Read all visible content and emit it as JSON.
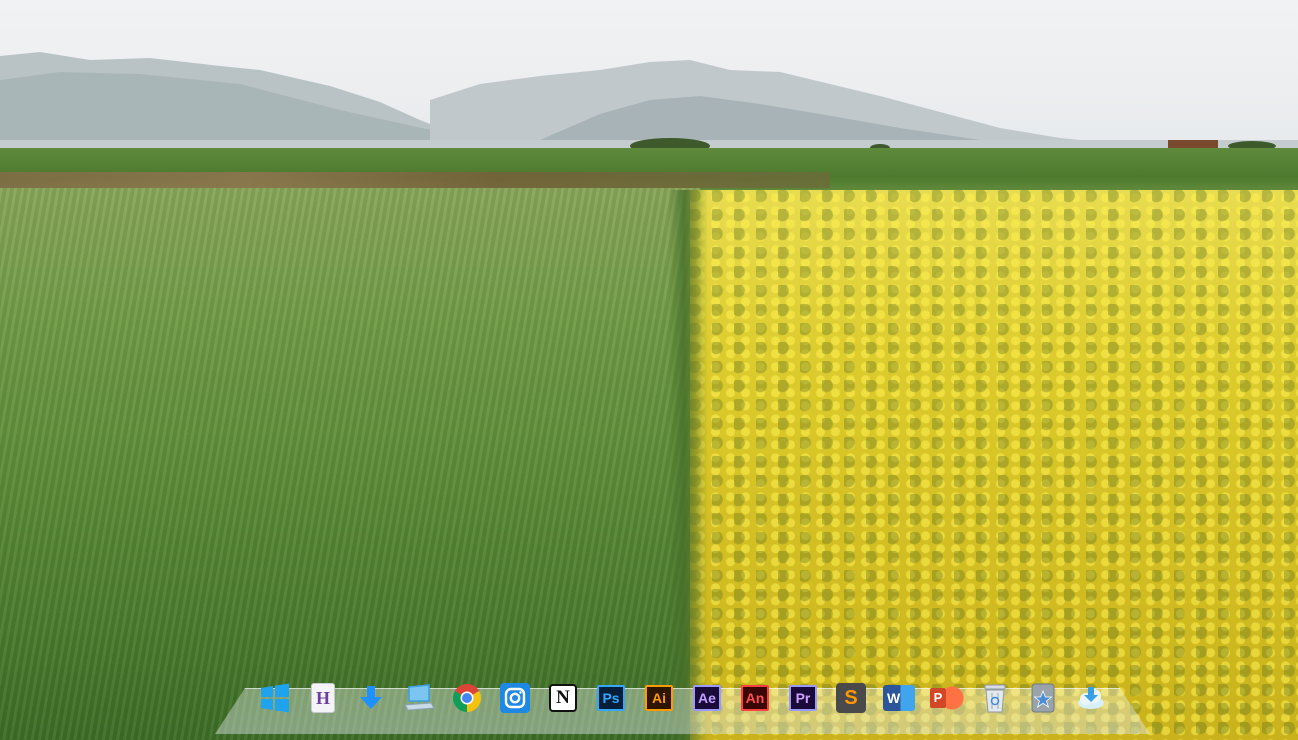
{
  "wallpaper": {
    "name": "wheat-and-rapeseed-field"
  },
  "dock": {
    "items": [
      {
        "name": "windows-start",
        "icon": "windows-logo-icon",
        "label": "",
        "color": "#1fa3ec"
      },
      {
        "name": "hbuilder",
        "icon": "h-document-icon",
        "label": "H",
        "color": "#6b3fa0"
      },
      {
        "name": "downloads",
        "icon": "download-arrow-icon",
        "label": "",
        "color": "#1e90ff"
      },
      {
        "name": "this-pc",
        "icon": "computer-icon",
        "label": "",
        "color": "#3ba0e0"
      },
      {
        "name": "chrome",
        "icon": "chrome-icon",
        "label": "",
        "color": "#db4437"
      },
      {
        "name": "instagram",
        "icon": "camera-icon",
        "label": "",
        "color": "#1e88e5"
      },
      {
        "name": "notion",
        "icon": "notion-icon",
        "label": "N",
        "color": "#111111"
      },
      {
        "name": "photoshop",
        "icon": "photoshop-icon",
        "label": "Ps",
        "color": "#31a8ff"
      },
      {
        "name": "illustrator",
        "icon": "illustrator-icon",
        "label": "Ai",
        "color": "#ff9a00"
      },
      {
        "name": "after-effects",
        "icon": "after-effects-icon",
        "label": "Ae",
        "color": "#9999ff"
      },
      {
        "name": "animate",
        "icon": "animate-icon",
        "label": "An",
        "color": "#ff4040"
      },
      {
        "name": "premiere",
        "icon": "premiere-icon",
        "label": "Pr",
        "color": "#9999ff"
      },
      {
        "name": "sublime-text",
        "icon": "sublime-icon",
        "label": "S",
        "color": "#ff9800"
      },
      {
        "name": "word",
        "icon": "word-icon",
        "label": "W",
        "color": "#2b579a"
      },
      {
        "name": "powerpoint",
        "icon": "powerpoint-icon",
        "label": "P",
        "color": "#d24726"
      },
      {
        "name": "recycle-bin",
        "icon": "recycle-bin-icon",
        "label": "",
        "color": "#aab4bc"
      },
      {
        "name": "favorites",
        "icon": "star-icon",
        "label": "",
        "color": "#4a8fd8"
      },
      {
        "name": "cloud-app",
        "icon": "cloud-icon",
        "label": "",
        "color": "#3aa0e6"
      }
    ]
  }
}
